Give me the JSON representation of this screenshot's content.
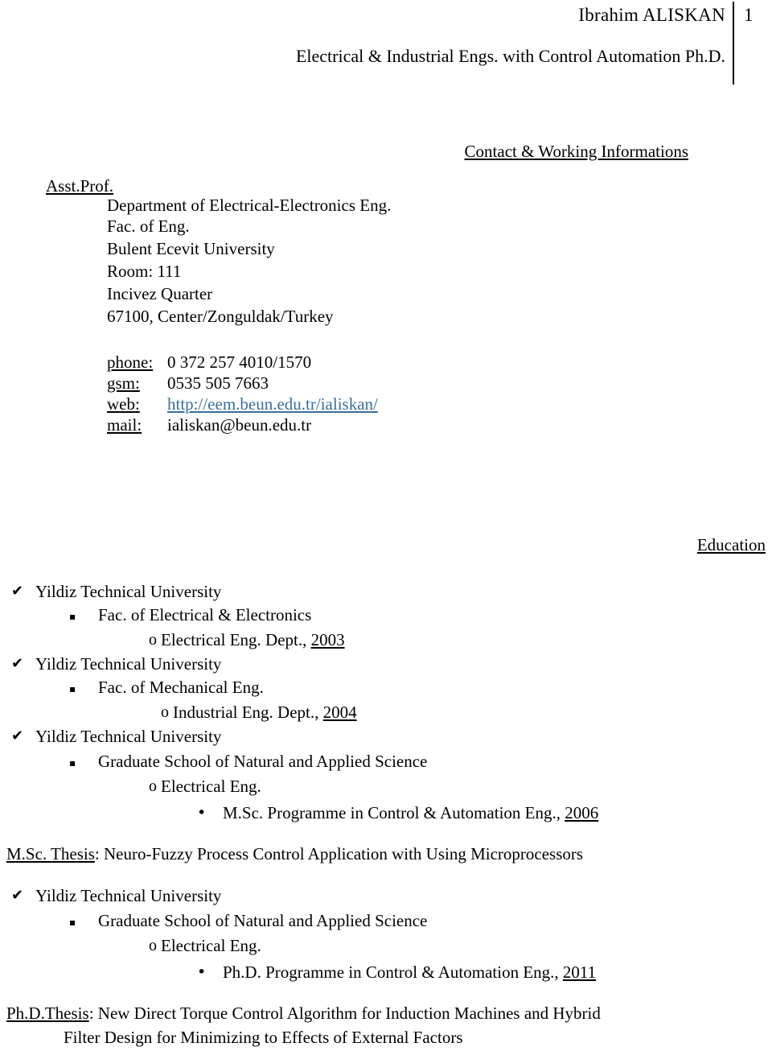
{
  "header": {
    "name": "Ibrahim ALISKAN",
    "page_number": "1",
    "subtitle": "Electrical & Industrial Engs. with Control Automation Ph.D."
  },
  "contact": {
    "heading": "Contact & Working Informations",
    "role_title": "Asst.Prof.",
    "address_lines": [
      "Department of Electrical-Electronics Eng.",
      "Fac. of Eng.",
      "Bulent Ecevit University",
      "Room: 111",
      "Incivez Quarter",
      "67100, Center/Zonguldak/Turkey"
    ],
    "fields": [
      {
        "label": "phone:",
        "value": "0 372 257 4010/1570",
        "is_link": false
      },
      {
        "label": "gsm:",
        "value": "0535 505 7663",
        "is_link": false
      },
      {
        "label": "web:",
        "value": "http://eem.beun.edu.tr/ialiskan/",
        "is_link": true
      },
      {
        "label": "mail:",
        "value": "ialiskan@beun.edu.tr",
        "is_link": false
      }
    ],
    "link_color": "#3c6e96"
  },
  "education": {
    "heading": "Education",
    "entries": [
      {
        "bullet": "check-bullet",
        "glyph": "✔",
        "university": "Yildiz Technical University",
        "faculty_bullet": "square-bullet",
        "faculty_glyph": "▪",
        "faculty": "Fac. of Electrical & Electronics",
        "department_bullet": "circle-bullet",
        "department_glyph": "o",
        "department": "Electrical Eng. Dept., ",
        "year": "2003"
      },
      {
        "bullet": "check-bullet",
        "glyph": "✔",
        "university": "Yildiz Technical University",
        "faculty_bullet": "square-bullet",
        "faculty_glyph": "▪",
        "faculty": "Fac. of Mechanical Eng.",
        "department_bullet": "circle-bullet",
        "department_glyph": "o",
        "department": "Industrial Eng. Dept., ",
        "year": "2004"
      },
      {
        "bullet": "check-bullet",
        "glyph": "✔",
        "university": "Yildiz Technical University",
        "faculty_bullet": "square-bullet",
        "faculty_glyph": "▪",
        "faculty": "Graduate School of Natural and Applied Science",
        "department_bullet": "circle-bullet",
        "department_glyph": "o",
        "department": "Electrical Eng.",
        "programme_bullet": "dot-bullet",
        "programme_glyph": "•",
        "programme": "M.Sc. Programme in Control & Automation Eng., ",
        "year": "2006"
      },
      {
        "bullet": "check-bullet",
        "glyph": "✔",
        "university": "Yildiz Technical University",
        "faculty_bullet": "square-bullet",
        "faculty_glyph": "▪",
        "faculty": "Graduate School of Natural and Applied Science",
        "department_bullet": "circle-bullet",
        "department_glyph": "o",
        "department": "Electrical Eng.",
        "programme_bullet": "dot-bullet",
        "programme_glyph": "•",
        "programme": "Ph.D. Programme in Control & Automation Eng., ",
        "year": "2011"
      }
    ],
    "msc_thesis": {
      "label": "M.Sc. Thesis",
      "separator": ": ",
      "title": "Neuro-Fuzzy Process Control Application with Using Microprocessors"
    },
    "phd_thesis": {
      "label": "Ph.D.Thesis",
      "separator": ": ",
      "title_line_1": "New Direct Torque Control Algorithm for Induction Machines and Hybrid",
      "title_line_2": "Filter Design for Minimizing to Effects of External Factors"
    }
  }
}
